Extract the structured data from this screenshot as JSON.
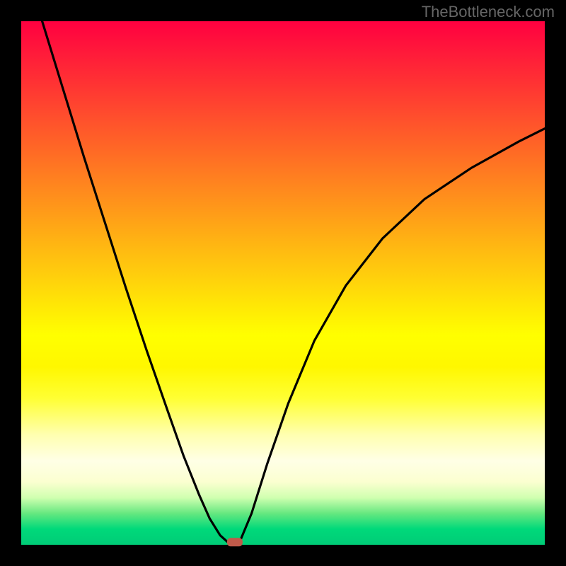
{
  "watermark": "TheBottleneck.com",
  "chart_data": {
    "type": "line",
    "title": "",
    "xlabel": "",
    "ylabel": "",
    "legend": false,
    "grid": false,
    "xlim": [
      0,
      1
    ],
    "ylim": [
      0,
      1
    ],
    "background_gradient": {
      "direction": "vertical",
      "stops": [
        {
          "pos": 0.0,
          "color": "#ff0040"
        },
        {
          "pos": 0.6,
          "color": "#ffff00"
        },
        {
          "pos": 0.84,
          "color": "#ffffe6"
        },
        {
          "pos": 1.0,
          "color": "#00cc77"
        }
      ]
    },
    "series": [
      {
        "name": "left-branch",
        "x": [
          0.04,
          0.08,
          0.12,
          0.16,
          0.2,
          0.24,
          0.28,
          0.31,
          0.34,
          0.36,
          0.38,
          0.4
        ],
        "y": [
          1.0,
          0.87,
          0.74,
          0.615,
          0.49,
          0.37,
          0.255,
          0.17,
          0.095,
          0.05,
          0.018,
          0.0
        ]
      },
      {
        "name": "right-branch",
        "x": [
          0.415,
          0.44,
          0.47,
          0.51,
          0.56,
          0.62,
          0.69,
          0.77,
          0.86,
          0.95,
          1.0
        ],
        "y": [
          0.0,
          0.06,
          0.155,
          0.27,
          0.39,
          0.495,
          0.585,
          0.66,
          0.72,
          0.77,
          0.795
        ]
      }
    ],
    "marker": {
      "x": 0.408,
      "y": 0.005,
      "color": "#c05a4a",
      "shape": "rounded-rect"
    }
  }
}
